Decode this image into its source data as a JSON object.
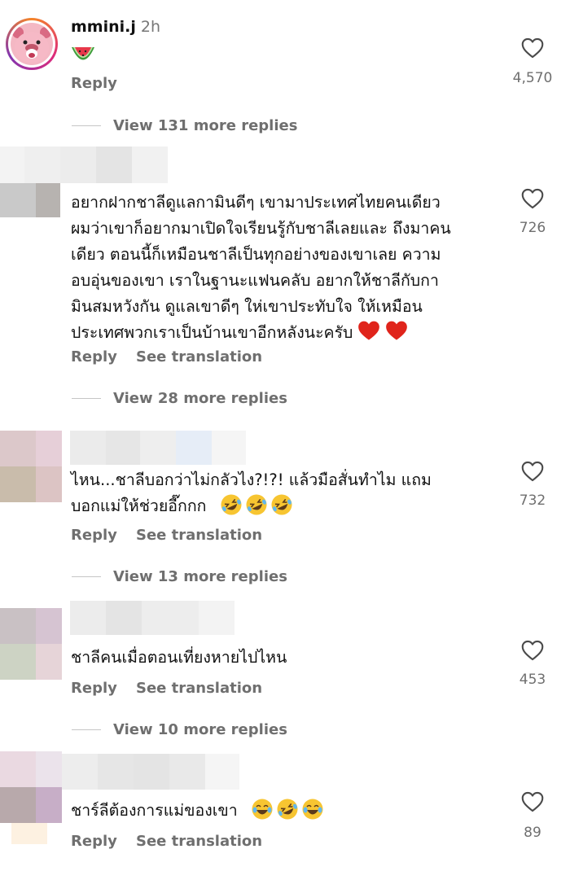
{
  "comments": [
    {
      "username": "mmini.j",
      "time": "2h",
      "text_lines": [],
      "likes": "4,570",
      "reply_label": "Reply",
      "view_more": "View 131 more replies"
    },
    {
      "username": "",
      "text_lines": [
        "อยากฝากชาลีดูแลกามินดีๆ เขามาประเทศไทยคนเดียว",
        "ผมว่าเขาก็อยากมาเปิดใจเรียนรู้กับชาลีเลยและ ถึงมาคน",
        "เดียว ตอนนี้ก็เหมือนชาลีเป็นทุกอย่างของเขาเลย ความ",
        "อบอุ่นของเขา เราในฐานะแฟนคลับ อยากให้ชาลีกับกา",
        "มินสมหวังกัน ดูแลเขาดีๆ ให่เขาประทับใจ ให้เหมือน",
        "ประเทศพวกเราเป็นบ้านเขาอีกหลังนะครับ"
      ],
      "likes": "726",
      "reply_label": "Reply",
      "translation_label": "See translation",
      "view_more": "View 28 more replies"
    },
    {
      "username": "",
      "text_lines": [
        "ไหน...ชาลีบอกว่าไม่กลัวไง?!?! แล้วมือสั่นทำไม แถม",
        "บอกแม่ให้ช่วยอี๊กกก"
      ],
      "likes": "732",
      "reply_label": "Reply",
      "translation_label": "See translation",
      "view_more": "View 13 more replies"
    },
    {
      "username": "",
      "text_lines": [
        "ชาลีคนเมื่อตอนเที่ยงหายไปไหน"
      ],
      "likes": "453",
      "reply_label": "Reply",
      "translation_label": "See translation",
      "view_more": "View 10 more replies"
    },
    {
      "username": "",
      "text_lines": [
        "ชาร์ลีต้องการแม่ของเขา"
      ],
      "likes": "89",
      "reply_label": "Reply",
      "translation_label": "See translation"
    }
  ],
  "icons": {
    "like": "heart-outline-icon",
    "emoji_watermelon": "watermelon-emoji",
    "emoji_red_heart": "red-heart-emoji",
    "emoji_rofl": "rofl-emoji",
    "emoji_tears_of_joy": "tears-of-joy-emoji"
  },
  "colors": {
    "text_primary": "#111111",
    "text_secondary": "#6f6f6f",
    "heart_red": "#e0241b",
    "emoji_yellow": "#f7c531"
  }
}
